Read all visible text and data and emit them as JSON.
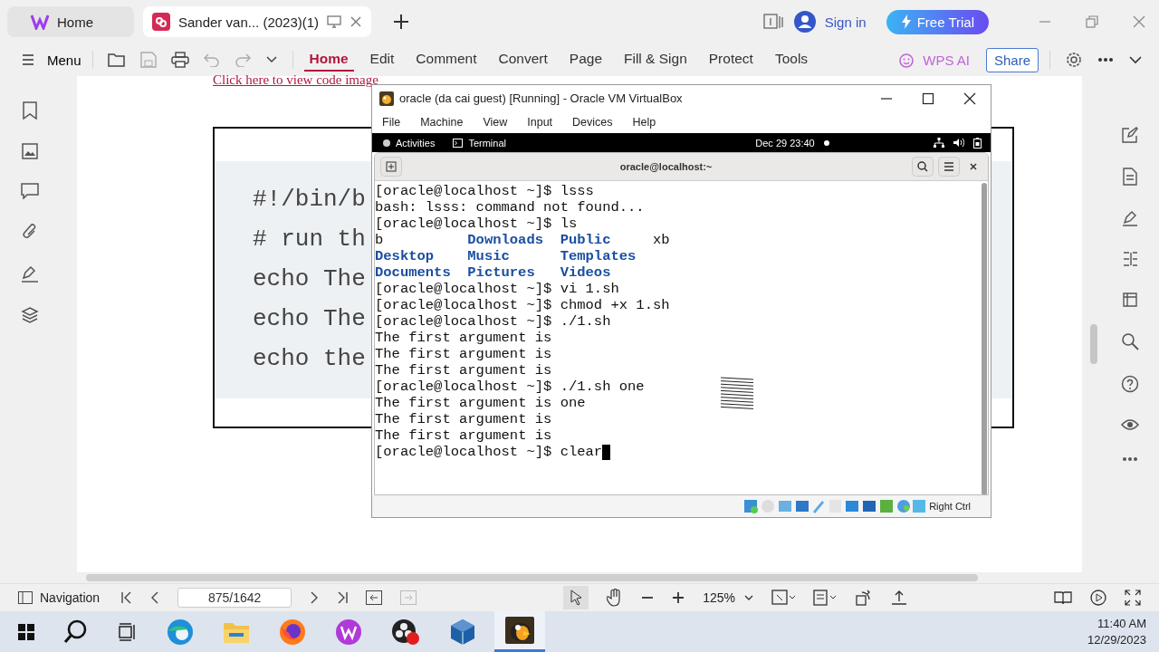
{
  "tabs": [
    {
      "label": "Home",
      "selected": false,
      "kind": "home"
    },
    {
      "label": "Sander van... (2023)(1)",
      "selected": true,
      "kind": "doc"
    }
  ],
  "account": {
    "sign_in": "Sign in",
    "trial": "Free Trial"
  },
  "toolbar": {
    "menu": "Menu",
    "ribbon": [
      {
        "label": "Home",
        "selected": true
      },
      {
        "label": "Edit",
        "selected": false
      },
      {
        "label": "Comment",
        "selected": false
      },
      {
        "label": "Convert",
        "selected": false
      },
      {
        "label": "Page",
        "selected": false
      },
      {
        "label": "Fill & Sign",
        "selected": false
      },
      {
        "label": "Protect",
        "selected": false
      },
      {
        "label": "Tools",
        "selected": false
      }
    ],
    "ai": "WPS AI",
    "share": "Share"
  },
  "document": {
    "link": "Click here to view code image",
    "code_lines": [
      "#!/bin/b",
      "# run th",
      "echo The",
      "echo The",
      "echo the"
    ]
  },
  "vm_window": {
    "title": "oracle (da cai guest) [Running] - Oracle VM VirtualBox",
    "menu": [
      "File",
      "Machine",
      "View",
      "Input",
      "Devices",
      "Help"
    ],
    "gnome_bar": {
      "activities": "Activities",
      "app": "Terminal",
      "clock": "Dec 29  23:40"
    },
    "terminal_title": "oracle@localhost:~",
    "lines": [
      {
        "kind": "text",
        "text": "[oracle@localhost ~]$ lsss"
      },
      {
        "kind": "text",
        "text": "bash: lsss: command not found..."
      },
      {
        "kind": "text",
        "text": "[oracle@localhost ~]$ ls"
      },
      {
        "kind": "ls",
        "cells": [
          {
            "text": "b",
            "directory": false
          },
          {
            "text": "Downloads",
            "directory": true
          },
          {
            "text": "Public",
            "directory": true
          },
          {
            "text": "xb",
            "directory": false
          }
        ]
      },
      {
        "kind": "ls",
        "cells": [
          {
            "text": "Desktop",
            "directory": true
          },
          {
            "text": "Music",
            "directory": true
          },
          {
            "text": "Templates",
            "directory": true
          }
        ]
      },
      {
        "kind": "ls",
        "cells": [
          {
            "text": "Documents",
            "directory": true
          },
          {
            "text": "Pictures",
            "directory": true
          },
          {
            "text": "Videos",
            "directory": true
          }
        ]
      },
      {
        "kind": "text",
        "text": "[oracle@localhost ~]$ vi 1.sh"
      },
      {
        "kind": "text",
        "text": "[oracle@localhost ~]$ chmod +x 1.sh"
      },
      {
        "kind": "text",
        "text": "[oracle@localhost ~]$ ./1.sh"
      },
      {
        "kind": "text",
        "text": "The first argument is"
      },
      {
        "kind": "text",
        "text": "The first argument is"
      },
      {
        "kind": "text",
        "text": "The first argument is"
      },
      {
        "kind": "text",
        "text": "[oracle@localhost ~]$ ./1.sh one"
      },
      {
        "kind": "text",
        "text": "The first argument is one"
      },
      {
        "kind": "text",
        "text": "The first argument is"
      },
      {
        "kind": "text",
        "text": "The first argument is"
      },
      {
        "kind": "text",
        "text": "[oracle@localhost ~]$ clear",
        "cursor": true
      }
    ],
    "host_key": "Right Ctrl"
  },
  "status_bar": {
    "navigation": "Navigation",
    "page": "875/1642",
    "zoom": "125%"
  },
  "taskbar": {
    "time": "11:40 AM",
    "date": "12/29/2023"
  }
}
